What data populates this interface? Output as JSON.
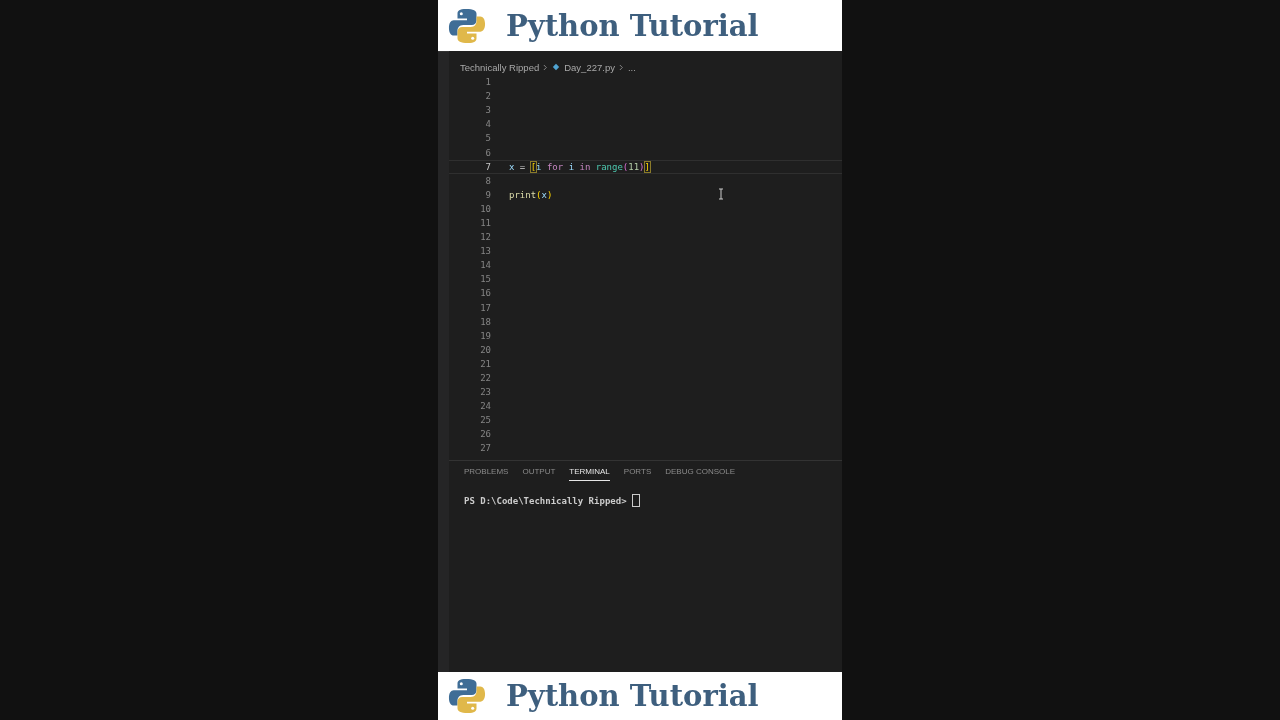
{
  "banner_top": {
    "title": "Python Tutorial"
  },
  "breadcrumb": [
    {
      "text": "Technically Ripped",
      "kind": "folder"
    },
    {
      "text": "Day_227.py",
      "kind": "file"
    },
    {
      "text": "...",
      "kind": "more"
    }
  ],
  "editor": {
    "lines": [
      {
        "number": "1",
        "current": false
      },
      {
        "number": "2",
        "current": false
      },
      {
        "number": "3",
        "current": false
      },
      {
        "number": "4",
        "current": false
      },
      {
        "number": "5",
        "current": false
      },
      {
        "number": "6",
        "current": false
      },
      {
        "number": "7",
        "current": true,
        "tokens": [
          {
            "text": "x",
            "kind": "var"
          },
          {
            "text": " = ",
            "kind": "op"
          },
          {
            "text": "[",
            "kind": "bracket",
            "match": true
          },
          {
            "text": "i",
            "kind": "var"
          },
          {
            "text": " for ",
            "kind": "keyword"
          },
          {
            "text": "i",
            "kind": "var"
          },
          {
            "text": " in ",
            "kind": "keyword"
          },
          {
            "text": "range",
            "kind": "class"
          },
          {
            "text": "(",
            "kind": "paren2"
          },
          {
            "text": "11",
            "kind": "number"
          },
          {
            "text": ")",
            "kind": "paren2"
          },
          {
            "text": "]",
            "kind": "bracket",
            "match": true
          }
        ]
      },
      {
        "number": "8",
        "current": false
      },
      {
        "number": "9",
        "current": false,
        "tokens": [
          {
            "text": "print",
            "kind": "func"
          },
          {
            "text": "(",
            "kind": "bracket"
          },
          {
            "text": "x",
            "kind": "var"
          },
          {
            "text": ")",
            "kind": "bracket"
          }
        ]
      },
      {
        "number": "10",
        "current": false
      },
      {
        "number": "11",
        "current": false
      },
      {
        "number": "12",
        "current": false
      },
      {
        "number": "13",
        "current": false
      },
      {
        "number": "14",
        "current": false
      },
      {
        "number": "15",
        "current": false
      },
      {
        "number": "16",
        "current": false
      },
      {
        "number": "17",
        "current": false
      },
      {
        "number": "18",
        "current": false
      },
      {
        "number": "19",
        "current": false
      },
      {
        "number": "20",
        "current": false
      },
      {
        "number": "21",
        "current": false
      },
      {
        "number": "22",
        "current": false
      },
      {
        "number": "23",
        "current": false
      },
      {
        "number": "24",
        "current": false
      },
      {
        "number": "25",
        "current": false
      },
      {
        "number": "26",
        "current": false
      },
      {
        "number": "27",
        "current": false
      }
    ]
  },
  "panel": {
    "tabs": [
      {
        "label": "PROBLEMS",
        "selected": false
      },
      {
        "label": "OUTPUT",
        "selected": false
      },
      {
        "label": "TERMINAL",
        "selected": true
      },
      {
        "label": "PORTS",
        "selected": false
      },
      {
        "label": "DEBUG CONSOLE",
        "selected": false
      }
    ],
    "terminal": {
      "prompt": "PS D:\\Code\\Technically Ripped>"
    }
  },
  "banner_bottom": {
    "title": "Python Tutorial"
  }
}
